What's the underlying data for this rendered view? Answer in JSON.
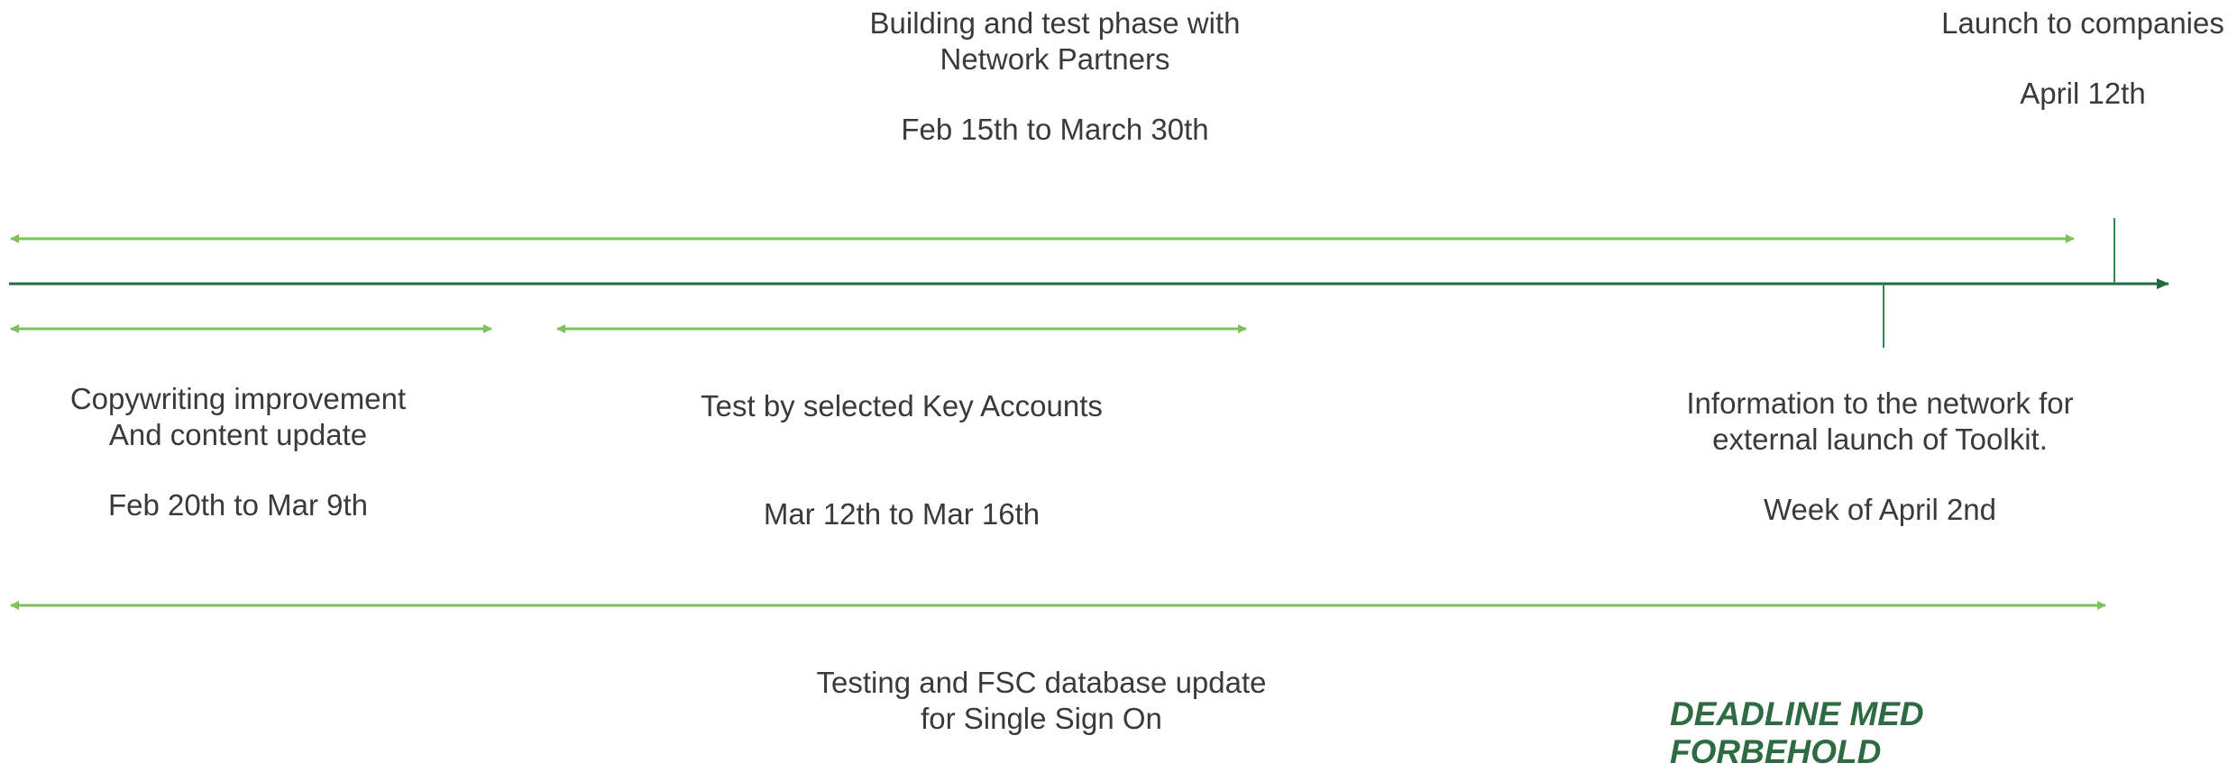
{
  "colors": {
    "main_axis": "#1f6b43",
    "span_arrow": "#7cc15a",
    "marker": "#2e8a55",
    "text": "#3a3a3a",
    "deadline": "#2e6b42"
  },
  "phases": {
    "building": {
      "line1": "Building and test phase with",
      "line2": "Network Partners",
      "dates": "Feb 15th to March 30th"
    },
    "launch": {
      "title": "Launch to companies",
      "date": "April 12th"
    },
    "copywriting": {
      "line1": "Copywriting improvement",
      "line2": "And content update",
      "dates": "Feb 20th to Mar 9th"
    },
    "key_accounts": {
      "title": "Test by selected Key Accounts",
      "dates": "Mar 12th to Mar 16th"
    },
    "network_info": {
      "line1": "Information to the network for",
      "line2": "external launch of Toolkit.",
      "date": "Week of April 2nd"
    },
    "sso": {
      "line1": "Testing and FSC database update",
      "line2": "for Single Sign On"
    }
  },
  "deadline": {
    "line1": "DEADLINE MED",
    "line2": "FORBEHOLD"
  }
}
